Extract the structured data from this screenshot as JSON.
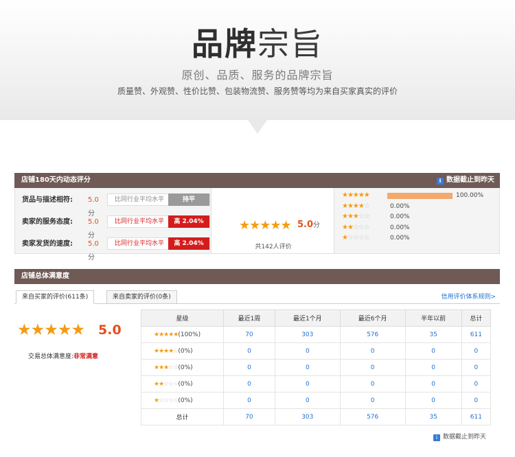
{
  "hero": {
    "title_bold": "品牌",
    "title_light": "宗旨",
    "subtitle": "原创、品质、服务的品牌宗旨",
    "desc": "质量赞、外观赞、性价比赞、包装物流赞、服务赞等均为来自买家真实的评价"
  },
  "dsr": {
    "title": "店铺180天内动态评分",
    "asof": "数据截止到昨天",
    "rows": [
      {
        "label": "货品与描述相符:",
        "score": "5.0",
        "unit": "分",
        "compare": "比同行业平均水平",
        "tag": "持平",
        "tag_type": "gray"
      },
      {
        "label": "卖家的服务态度:",
        "score": "5.0",
        "unit": "分",
        "compare": "比同行业平均水平",
        "tag": "高 2.04%",
        "tag_type": "red"
      },
      {
        "label": "卖家发货的速度:",
        "score": "5.0",
        "unit": "分",
        "compare": "比同行业平均水平",
        "tag": "高 2.04%",
        "tag_type": "red"
      }
    ],
    "overall": {
      "stars": "★★★★★",
      "score": "5.0",
      "unit": "分",
      "count": "共142人评价"
    },
    "distribution": [
      {
        "stars": 5,
        "percent": 100,
        "label": "100.00%"
      },
      {
        "stars": 4,
        "percent": 0,
        "label": "0.00%"
      },
      {
        "stars": 3,
        "percent": 0,
        "label": "0.00%"
      },
      {
        "stars": 2,
        "percent": 0,
        "label": "0.00%"
      },
      {
        "stars": 1,
        "percent": 0,
        "label": "0.00%"
      }
    ]
  },
  "overall_section": {
    "title": "店铺总体满意度",
    "tabs": [
      {
        "label": "来自买家的评价(611条)"
      },
      {
        "label": "来自卖家的评价(0条)"
      }
    ],
    "rules_link": "信用评价体系规则>",
    "summary_stars": "★★★★★",
    "summary_score": "5.0",
    "satisfaction_label": "交易总体满意度:",
    "satisfaction_value": "非常满意",
    "table": {
      "headers": [
        "星级",
        "最近1周",
        "最近1个月",
        "最近6个月",
        "半年以前",
        "总计"
      ],
      "rows": [
        {
          "stars": 5,
          "pct": "(100%)",
          "values": [
            "70",
            "303",
            "576",
            "35",
            "611"
          ]
        },
        {
          "stars": 4,
          "pct": "(0%)",
          "values": [
            "0",
            "0",
            "0",
            "0",
            "0"
          ]
        },
        {
          "stars": 3,
          "pct": "(0%)",
          "values": [
            "0",
            "0",
            "0",
            "0",
            "0"
          ]
        },
        {
          "stars": 2,
          "pct": "(0%)",
          "values": [
            "0",
            "0",
            "0",
            "0",
            "0"
          ]
        },
        {
          "stars": 1,
          "pct": "(0%)",
          "values": [
            "0",
            "0",
            "0",
            "0",
            "0"
          ]
        }
      ],
      "total_label": "总计",
      "totals": [
        "70",
        "303",
        "576",
        "35",
        "611"
      ]
    },
    "footnote": "数据截止到昨天"
  },
  "colors": {
    "bar": "#6f5a55",
    "star": "#f39c12",
    "accent": "#e4501c",
    "tag_red": "#d41c1c",
    "link": "#1f6fd4"
  },
  "icons": {
    "info": "info-icon",
    "star": "star-icon"
  }
}
